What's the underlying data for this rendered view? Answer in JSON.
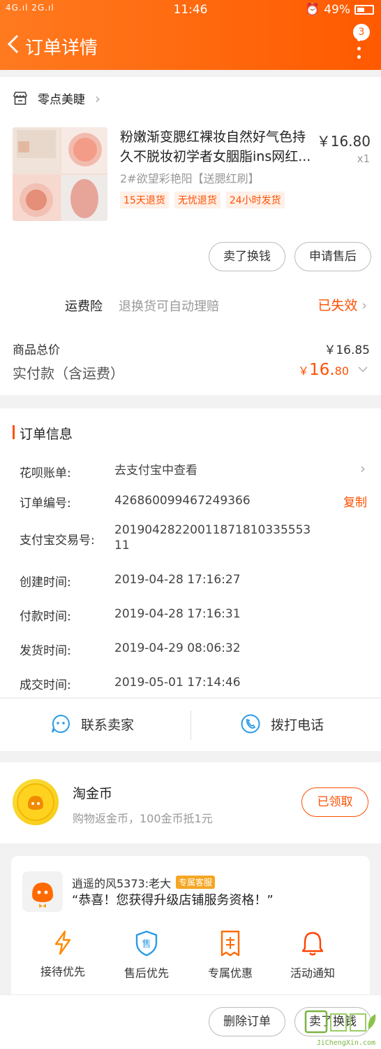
{
  "status_bar": {
    "signal": "4G.ıl 2G.ıl",
    "time": "11:46",
    "battery": "49%"
  },
  "header": {
    "title": "订单详情",
    "badge_count": "3"
  },
  "shop": {
    "name": "零点美睫"
  },
  "product": {
    "title": "粉嫩渐变腮红裸妆自然好气色持久不脱妆初学者女胭脂ins网红...",
    "price": "￥16.80",
    "qty": "x1",
    "sku": "2#欲望彩艳阳【送腮红刷】",
    "tags": [
      "15天退货",
      "无忧退货",
      "24小时发货"
    ]
  },
  "item_actions": {
    "sell_exchange": "卖了换钱",
    "after_sale": "申请售后"
  },
  "insurance": {
    "label": "运费险",
    "desc": "退换货可自动理赔",
    "status": "已失效"
  },
  "totals": {
    "goods_label": "商品总价",
    "goods_value": "￥16.85",
    "paid_label": "实付款（含运费）",
    "paid_symbol": "￥",
    "paid_int": "16.",
    "paid_dec": "80"
  },
  "order_info": {
    "title": "订单信息",
    "rows": [
      {
        "label": "花呗账单:",
        "value": "去支付宝中查看"
      },
      {
        "label": "订单编号:",
        "value": "426860099467249366"
      },
      {
        "label": "支付宝交易号:",
        "value": "20190428220011871810335553 11"
      },
      {
        "label": "创建时间:",
        "value": "2019-04-28 17:16:27"
      },
      {
        "label": "付款时间:",
        "value": "2019-04-28 17:16:31"
      },
      {
        "label": "发货时间:",
        "value": "2019-04-29 08:06:32"
      },
      {
        "label": "成交时间:",
        "value": "2019-05-01 17:14:46"
      }
    ],
    "copy_label": "复制"
  },
  "contact": {
    "seller": "联系卖家",
    "phone": "拨打电话"
  },
  "coin": {
    "title": "淘金币",
    "desc": "购物返金币，100金币抵1元",
    "button": "已领取"
  },
  "service": {
    "name": "逍遥的风5373:老大",
    "badge": "专属客服",
    "message": "“恭喜！您获得升级店铺服务资格！”",
    "perks": [
      "接待优先",
      "售后优先",
      "专属优惠",
      "活动通知"
    ]
  },
  "bottom": {
    "delete": "删除订单",
    "sell": "卖了换钱"
  },
  "watermark": {
    "text": "JiChengXin.com"
  },
  "colors": {
    "accent": "#ff5000",
    "header": "#ff6a00"
  }
}
